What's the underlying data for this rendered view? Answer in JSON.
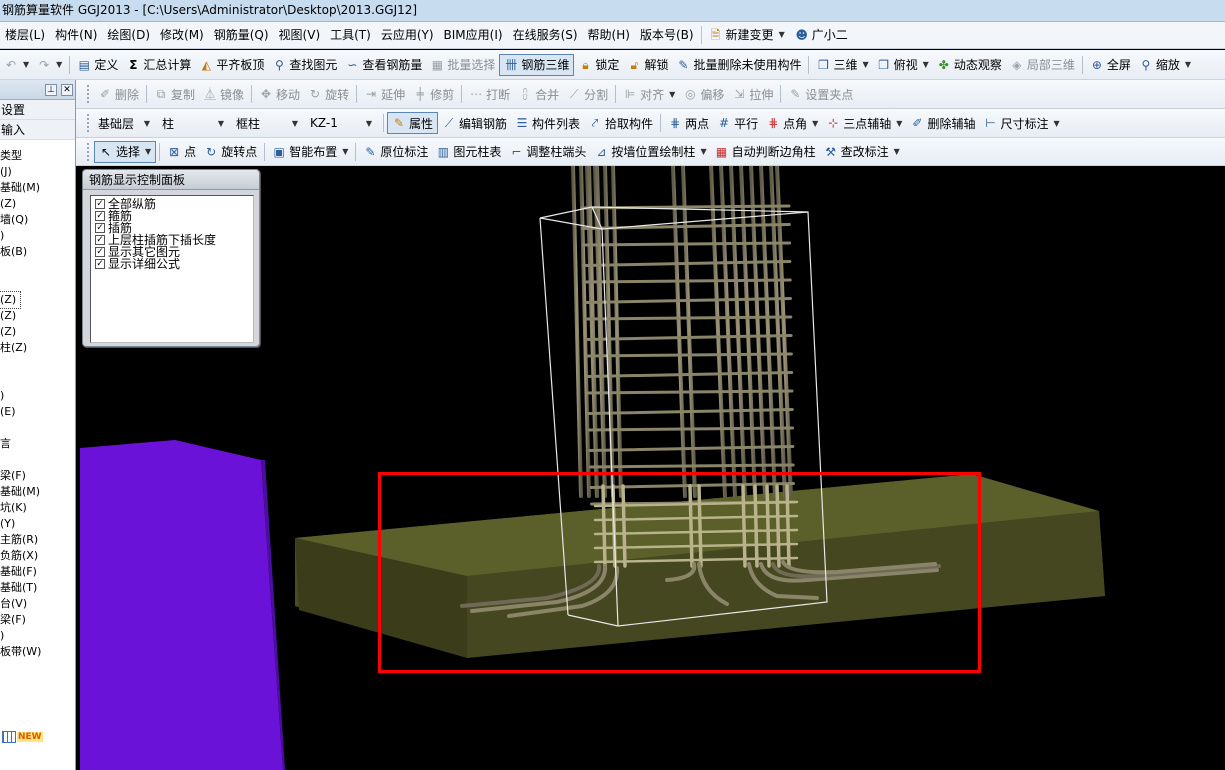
{
  "window": {
    "title": "钢筋算量软件 GGJ2013 - [C:\\Users\\Administrator\\Desktop\\2013.GGJ12]"
  },
  "menu": {
    "items": [
      "楼层(L)",
      "构件(N)",
      "绘图(D)",
      "修改(M)",
      "钢筋量(Q)",
      "视图(V)",
      "工具(T)",
      "云应用(Y)",
      "BIM应用(I)",
      "在线服务(S)",
      "帮助(H)",
      "版本号(B)"
    ],
    "new_change": "新建变更",
    "assistant": "广小二"
  },
  "toolbar1": {
    "define": "定义",
    "sum_calc": "汇总计算",
    "flush_slab_top": "平齐板顶",
    "find_element": "查找图元",
    "view_rebar_qty": "查看钢筋量",
    "batch_select": "批量选择",
    "rebar_3d": "钢筋三维",
    "lock": "锁定",
    "unlock": "解锁",
    "batch_delete_unused": "批量删除未使用构件",
    "three_d": "三维",
    "top_view": "俯视",
    "dynamic_observe": "动态观察",
    "local_3d": "局部三维",
    "fullscreen": "全屏",
    "zoom": "缩放"
  },
  "toolbar2": {
    "delete": "删除",
    "copy": "复制",
    "mirror": "镜像",
    "move": "移动",
    "rotate": "旋转",
    "extend": "延伸",
    "trim": "修剪",
    "break": "打断",
    "merge": "合并",
    "split": "分割",
    "align": "对齐",
    "offset": "偏移",
    "stretch": "拉伸",
    "set_grip": "设置夹点"
  },
  "toolbar3": {
    "floor": "基础层",
    "category": "柱",
    "subtype": "框柱",
    "component": "KZ-1",
    "properties": "属性",
    "edit_rebar": "编辑钢筋",
    "component_list": "构件列表",
    "pick_component": "拾取构件",
    "two_points": "两点",
    "parallel": "平行",
    "point_angle": "点角",
    "three_point_axis": "三点辅轴",
    "delete_axis": "删除辅轴",
    "dimension": "尺寸标注"
  },
  "toolbar4": {
    "select": "选择",
    "point": "点",
    "rotate_point": "旋转点",
    "smart_layout": "智能布置",
    "in_place_label": "原位标注",
    "element_column_table": "图元柱表",
    "adjust_column_end": "调整柱端头",
    "draw_by_wall": "按墙位置绘制柱",
    "auto_corner_column": "自动判断边角柱",
    "modify_label": "查改标注"
  },
  "sidebar": {
    "header1": "设置",
    "header2": "输入",
    "items": [
      "类型",
      "(J)",
      "基础(M)",
      "(Z)",
      "墙(Q)",
      ")",
      "板(B)",
      "",
      "",
      "(Z)",
      "(Z)",
      "(Z)",
      "柱(Z)",
      "",
      "",
      ")",
      "(E)",
      "",
      "言",
      "",
      "梁(F)",
      "基础(M)",
      "坑(K)",
      "(Y)",
      "主筋(R)",
      "负筋(X)",
      "基础(F)",
      "基础(T)",
      "台(V)",
      "梁(F)",
      ")",
      "板带(W)"
    ],
    "selected_index": 9,
    "new_badge": "NEW"
  },
  "rebar_panel": {
    "title": "钢筋显示控制面板",
    "options": [
      {
        "label": "全部纵筋",
        "checked": true
      },
      {
        "label": "箍筋",
        "checked": true
      },
      {
        "label": "插筋",
        "checked": true
      },
      {
        "label": "上层柱插筋下插长度",
        "checked": true
      },
      {
        "label": "显示其它图元",
        "checked": true
      },
      {
        "label": "显示详细公式",
        "checked": true
      }
    ]
  },
  "colors": {
    "footing": "#4a4d22",
    "rebar": "#8a8468",
    "purple_wall": "#6a12d8",
    "highlight": "#ff0000"
  }
}
